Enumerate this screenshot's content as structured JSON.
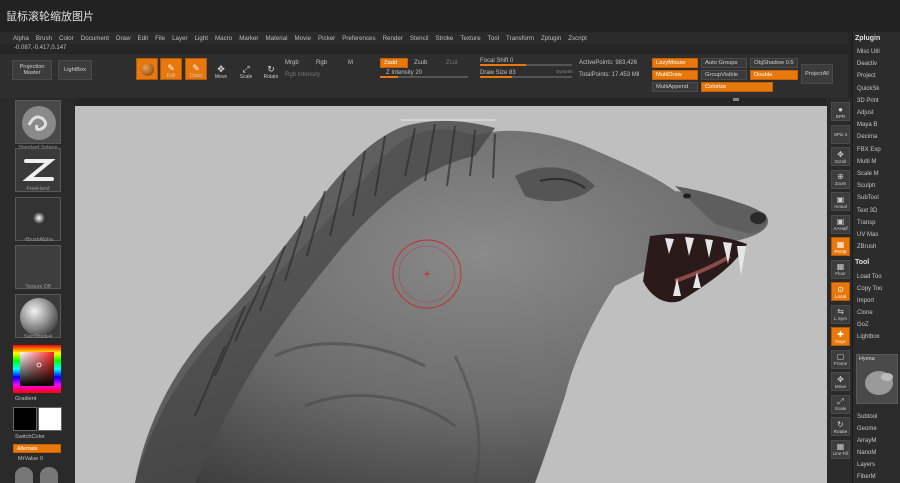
{
  "title": "鼠标滚轮缩放图片",
  "menu": [
    "Alpha",
    "Brush",
    "Color",
    "Document",
    "Draw",
    "Edit",
    "File",
    "Layer",
    "Light",
    "Macro",
    "Marker",
    "Material",
    "Movie",
    "Picker",
    "Preferences",
    "Render",
    "Stencil",
    "Stroke",
    "Texture",
    "Tool",
    "Transform",
    "Zplugin",
    "Zscript"
  ],
  "coords": "-0.087,-0.417,0.147",
  "topshelf": {
    "projection_master": "Projection Master",
    "lightbox": "LightBox",
    "tools": [
      {
        "name": "Edit",
        "glyph": "✎",
        "on": true
      },
      {
        "name": "Draw",
        "glyph": "✎",
        "on": true
      },
      {
        "name": "Move",
        "glyph": "✥",
        "on": false
      },
      {
        "name": "Scale",
        "glyph": "⤢",
        "on": false
      },
      {
        "name": "Rotate",
        "glyph": "↻",
        "on": false
      }
    ],
    "mrgb": "Mrgb",
    "rgb": "Rgb",
    "m": "M",
    "zadd": "Zadd",
    "zsub": "Zsub",
    "zcut": "Zcut",
    "rgb_intensity": "Rgb Intensity",
    "z_intensity": "Z Intensity 20",
    "z_intensity_value": 0.2,
    "focal_shift": "Focal Shift 0",
    "focal_shift_value": 0.5,
    "draw_size": "Draw Size 83",
    "draw_size_value": 0.35,
    "dynamic": "Dynamic",
    "active_points": "ActivePoints: 983,426",
    "total_points": "TotalPoints: 17.453 Mil",
    "lazymouse": "LazyMouse",
    "multidraw": "MultiDraw",
    "multiappend": "MultiAppend",
    "auto_groups": "Auto Groups",
    "group_visible": "GroupVisible",
    "colorize": "Colorize",
    "obj_shadow": "ObjShadow 0.5",
    "double": "Double",
    "project_all": "ProjectAll"
  },
  "lefttray": [
    {
      "caption": "Standard Sphere"
    },
    {
      "caption": "FreeHand"
    },
    {
      "caption": "~BrushAlpha"
    },
    {
      "caption": "Texture Off"
    },
    {
      "caption": "SkinShade4"
    }
  ],
  "left_labels": {
    "gradient": "Gradient",
    "switch_color": "SwitchColor",
    "alternate": "Alternate",
    "mrvalue": "MrValue 0"
  },
  "rightshelf": [
    {
      "label": "BPR",
      "glyph": "●",
      "on": false
    },
    {
      "label": "SPix 3",
      "glyph": "",
      "on": false
    },
    {
      "label": "Scroll",
      "glyph": "✥",
      "on": false
    },
    {
      "label": "Zoom",
      "glyph": "⊕",
      "on": false
    },
    {
      "label": "Actual",
      "glyph": "▣",
      "on": false
    },
    {
      "label": "AAHalf",
      "glyph": "▣",
      "on": false
    },
    {
      "label": "Persp",
      "glyph": "▦",
      "on": true
    },
    {
      "label": "Floor",
      "glyph": "▦",
      "on": false
    },
    {
      "label": "Local",
      "glyph": "⊙",
      "on": true
    },
    {
      "label": "L.Sym",
      "glyph": "⇆",
      "on": false
    },
    {
      "label": "Gxyz",
      "glyph": "✚",
      "on": true
    },
    {
      "label": "Frame",
      "glyph": "▢",
      "on": false
    },
    {
      "label": "Move",
      "glyph": "✥",
      "on": false
    },
    {
      "label": "Scale",
      "glyph": "⤢",
      "on": false
    },
    {
      "label": "Rotate",
      "glyph": "↻",
      "on": false
    },
    {
      "label": "Line Fill",
      "glyph": "▦",
      "on": false
    }
  ],
  "palette": {
    "header": "Zplugin",
    "items": [
      "Misc Util",
      "Deactiv",
      "Project",
      "QuickSk",
      "3D Print",
      "Adjust",
      "Maya B",
      "Decima",
      "FBX Exp",
      "Multi M",
      "Scale M",
      "Sculptr",
      "SubTool",
      "Text 3D",
      "Transp",
      "UV Mas",
      "ZBrush"
    ],
    "tool_header": "Tool",
    "tool_items": [
      "Load Too",
      "Copy Too",
      "Import",
      "Clone",
      "GoZ",
      "Lightbox"
    ],
    "tool_name": "Hyena",
    "tool_items2": [
      "Subtool",
      "Geome",
      "ArrayM",
      "NanoM",
      "Layers",
      "FiberM"
    ]
  },
  "colors": {
    "accent": "#e8780c",
    "viewport": "#bfbfbf",
    "panel": "#2b2b2b",
    "cursor_ring": "#d02020"
  }
}
